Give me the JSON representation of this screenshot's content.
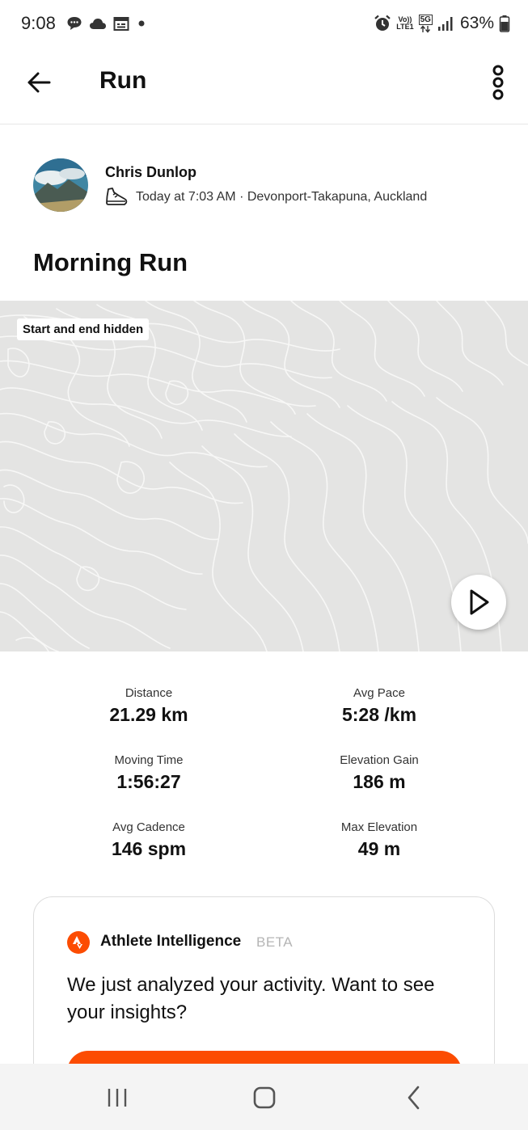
{
  "status_bar": {
    "time": "9:08",
    "network_top": "Vo))",
    "network_bottom": "LTE1",
    "fiveg_label": "5G",
    "battery_percent": "63%",
    "left_icons": [
      "chat-bubble-icon",
      "cloud-icon",
      "calendar-icon",
      "dot-icon"
    ],
    "right_icons": [
      "alarm-icon",
      "volte-icon",
      "5g-icon",
      "signal-icon",
      "battery-icon"
    ]
  },
  "app_bar": {
    "title": "Run",
    "back_icon": "arrow-left-icon",
    "more_icon": "more-vertical-icon"
  },
  "athlete": {
    "name": "Chris Dunlop",
    "activity_icon": "shoe-icon",
    "meta": "Today at 7:03 AM · Devonport-Takapuna, Auckland"
  },
  "activity": {
    "title": "Morning Run"
  },
  "map": {
    "privacy_tag": "Start and end hidden",
    "play_icon": "play-icon"
  },
  "stats": [
    {
      "label": "Distance",
      "value": "21.29 km"
    },
    {
      "label": "Avg Pace",
      "value": "5:28 /km"
    },
    {
      "label": "Moving Time",
      "value": "1:56:27"
    },
    {
      "label": "Elevation Gain",
      "value": "186 m"
    },
    {
      "label": "Avg Cadence",
      "value": "146 spm"
    },
    {
      "label": "Max Elevation",
      "value": "49 m"
    }
  ],
  "insights": {
    "title": "Athlete Intelligence",
    "badge": "BETA",
    "message": "We just analyzed your activity. Want to see your insights?",
    "accent_color": "#fc4c02"
  },
  "nav_bar": {
    "icons": [
      "recent-apps-icon",
      "home-icon",
      "back-nav-icon"
    ]
  }
}
